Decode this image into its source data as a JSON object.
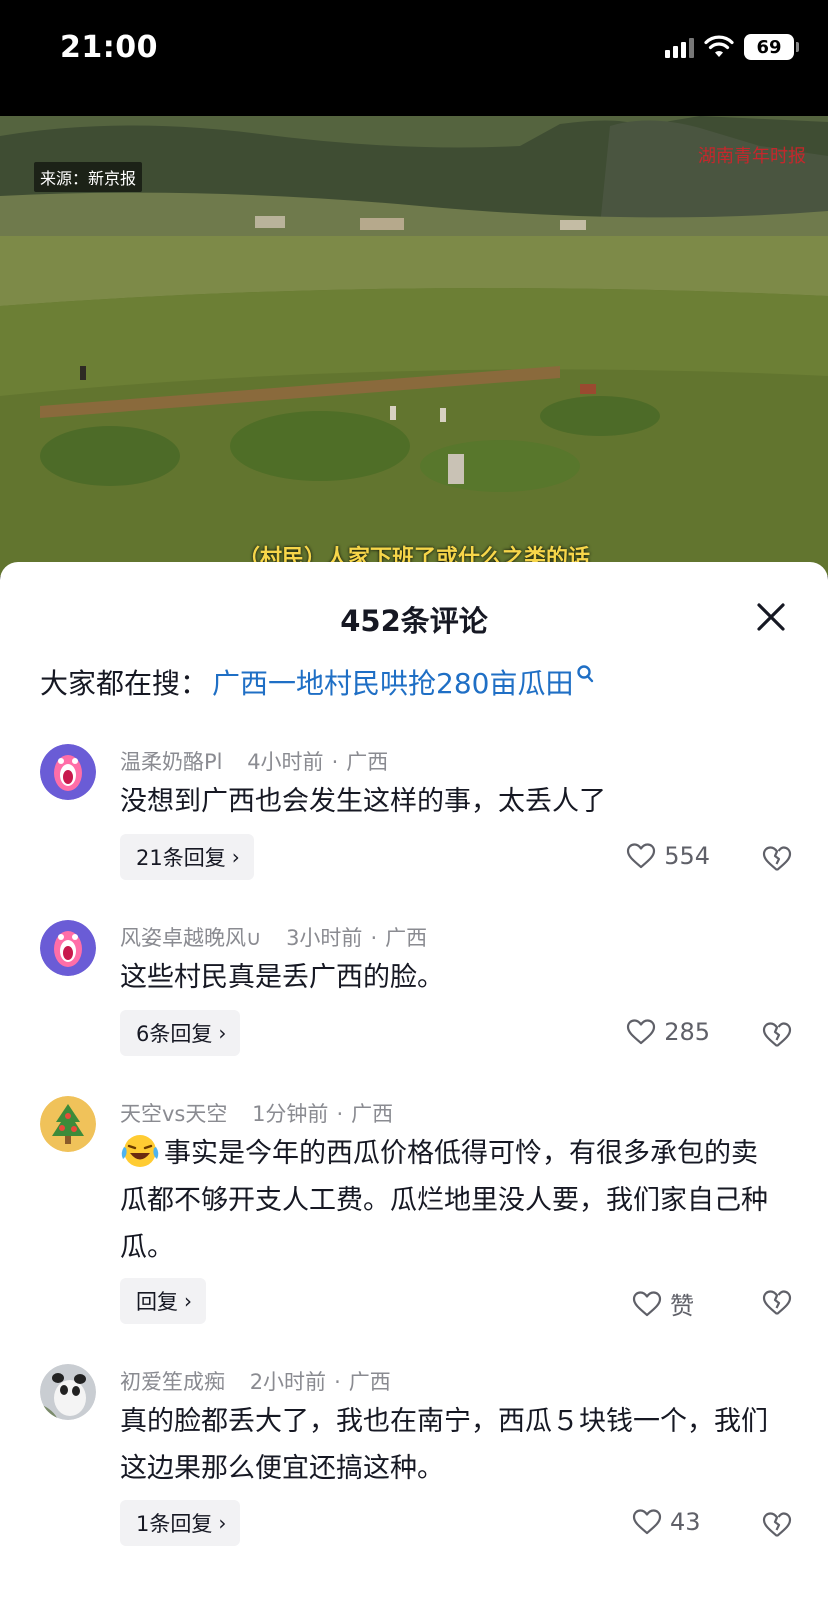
{
  "status_bar": {
    "time": "21:00",
    "battery": "69"
  },
  "video": {
    "source_tag": "来源：新京报",
    "watermark": "湖南青年时报",
    "subtitle": "（村民）人家下班了或什么之类的话"
  },
  "comments_panel": {
    "title": "452条评论",
    "search_prefix": "大家都在搜：",
    "search_link": "广西一地村民哄抢280亩瓜田",
    "comments": [
      {
        "username": "温柔奶酪Pl",
        "time": "4小时前",
        "location": "广西",
        "text": "没想到广西也会发生这样的事，太丢人了",
        "reply_label": "21条回复",
        "likes": "554"
      },
      {
        "username": "风姿卓越晚风∪",
        "time": "3小时前",
        "location": "广西",
        "text": "这些村民真是丢广西的脸。",
        "reply_label": "6条回复",
        "likes": "285"
      },
      {
        "username": "天空vs天空",
        "time": "1分钟前",
        "location": "广西",
        "text": "事实是今年的西瓜价格低得可怜，有很多承包的卖瓜都不够开支人工费。瓜烂地里没人要，我们家自己种瓜。",
        "reply_label": "回复",
        "likes": "赞"
      },
      {
        "username": "初爱笙成痴",
        "time": "2小时前",
        "location": "广西",
        "text": "真的脸都丢大了，我也在南宁，西瓜５块钱一个，我们这边果那么便宜还搞这种。",
        "reply_label": "1条回复",
        "likes": "43"
      }
    ]
  },
  "colors": {
    "link": "#1f6fc5",
    "meta": "#8a8b91",
    "reply_bg": "#f2f2f4"
  },
  "icons": [
    "signal-icon",
    "wifi-icon",
    "battery-icon",
    "close-icon",
    "search-icon",
    "heart-icon",
    "broken-heart-icon",
    "chevron-right-icon",
    "laughing-crying-emoji"
  ]
}
